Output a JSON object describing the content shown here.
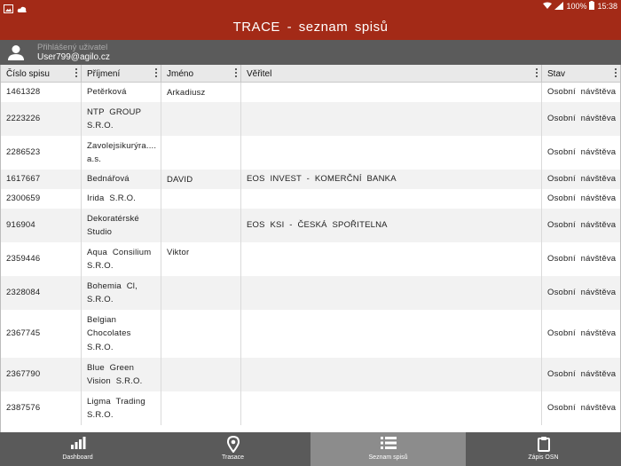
{
  "status_bar": {
    "battery": "100%",
    "time": "15:38"
  },
  "app_bar": {
    "title": "TRACE  -  seznam  spisů"
  },
  "user": {
    "caption": "Přihlášený uživatel",
    "email": "User799@agilo.cz"
  },
  "table": {
    "columns": [
      "Číslo spisu",
      "Příjmení",
      "Jméno",
      "Věřitel",
      "Stav"
    ],
    "rows": [
      {
        "cislo": "1461328",
        "prijmeni": [
          "Petěrková"
        ],
        "jmeno": "Arkadiusz",
        "veritel": "",
        "stav": "Osobní  návštěva"
      },
      {
        "cislo": "2223226",
        "prijmeni": [
          "NTP  GROUP",
          "S.R.O."
        ],
        "jmeno": "",
        "veritel": "",
        "stav": "Osobní  návštěva"
      },
      {
        "cislo": "2286523",
        "prijmeni": [
          "Zavolejsikurýra....",
          "a.s."
        ],
        "jmeno": "",
        "veritel": "",
        "stav": "Osobní  návštěva"
      },
      {
        "cislo": "1617667",
        "prijmeni": [
          "Bednářová"
        ],
        "jmeno": "DAVID",
        "veritel": "EOS  INVEST  -  KOMERČNÍ  BANKA",
        "stav": "Osobní  návštěva"
      },
      {
        "cislo": "2300659",
        "prijmeni": [
          "Irida  S.R.O."
        ],
        "jmeno": "",
        "veritel": "",
        "stav": "Osobní  návštěva"
      },
      {
        "cislo": "916904",
        "prijmeni": [
          "Dekoratérské",
          "Studio"
        ],
        "jmeno": "",
        "veritel": "EOS  KSI  -  ČESKÁ  SPOŘITELNA",
        "stav": "Osobní  návštěva"
      },
      {
        "cislo": "2359446",
        "prijmeni": [
          "Aqua  Consilium",
          "S.R.O."
        ],
        "jmeno": "Viktor",
        "veritel": "",
        "stav": "Osobní  návštěva"
      },
      {
        "cislo": "2328084",
        "prijmeni": [
          "Bohemia  Cl,",
          "S.R.O."
        ],
        "jmeno": "",
        "veritel": "",
        "stav": "Osobní  návštěva"
      },
      {
        "cislo": "2367745",
        "prijmeni": [
          "Belgian",
          "Chocolates",
          "S.R.O."
        ],
        "jmeno": "",
        "veritel": "",
        "stav": "Osobní  návštěva"
      },
      {
        "cislo": "2367790",
        "prijmeni": [
          "Blue  Green",
          "Vision  S.R.O."
        ],
        "jmeno": "",
        "veritel": "",
        "stav": "Osobní  návštěva"
      },
      {
        "cislo": "2387576",
        "prijmeni": [
          "Ligma  Trading",
          "S.R.O."
        ],
        "jmeno": "",
        "veritel": "",
        "stav": "Osobní  návštěva"
      }
    ]
  },
  "bottom_nav": {
    "items": [
      {
        "label": "Dashboard",
        "icon": "bar-chart-icon"
      },
      {
        "label": "Trasace",
        "icon": "map-pin-icon"
      },
      {
        "label": "Seznam spisů",
        "icon": "list-icon",
        "active": true
      },
      {
        "label": "Zápis OSN",
        "icon": "clipboard-icon"
      }
    ]
  },
  "colors": {
    "primary": "#a32a17",
    "user_bar": "#5b5b5b",
    "nav": "#5a5a5a",
    "nav_active": "#8c8c8c",
    "header_bg": "#e9e9e9",
    "row_alt": "#f2f2f2"
  }
}
